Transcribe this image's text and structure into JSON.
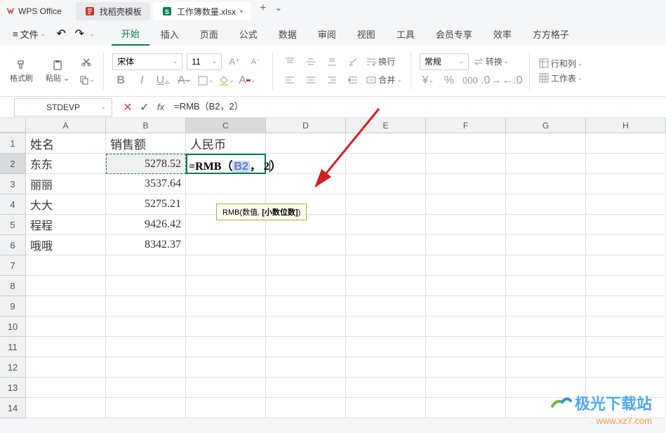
{
  "app": {
    "name": "WPS Office"
  },
  "tabs": [
    {
      "icon_color": "#c0392b",
      "label": "找稻壳模板"
    },
    {
      "icon_color": "#0a8050",
      "label": "工作簿数量.xlsx",
      "active": true
    }
  ],
  "menubar": {
    "file": "文件",
    "items": [
      "开始",
      "插入",
      "页面",
      "公式",
      "数据",
      "审阅",
      "视图",
      "工具",
      "会员专享",
      "效率",
      "方方格子"
    ],
    "active": 0
  },
  "ribbon": {
    "format_brush": "格式刷",
    "paste": "粘贴",
    "font": "宋体",
    "size": "11",
    "wrap": "换行",
    "merge": "合并",
    "numfmt": "常规",
    "convert": "转换",
    "rowcol": "行和列",
    "worksheet": "工作表"
  },
  "formula_bar": {
    "name": "STDEVP",
    "formula": "=RMB（B2，2）"
  },
  "columns": [
    "A",
    "B",
    "C",
    "D",
    "E",
    "F",
    "G",
    "H"
  ],
  "rows_shown": 14,
  "headers": {
    "A": "姓名",
    "B": "销售额",
    "C": "人民币"
  },
  "data": [
    {
      "A": "东东",
      "B": "5278.52"
    },
    {
      "A": "丽丽",
      "B": "3537.64"
    },
    {
      "A": "大大",
      "B": "5275.21"
    },
    {
      "A": "程程",
      "B": "9426.42"
    },
    {
      "A": "哦哦",
      "B": "8342.37"
    }
  ],
  "editing": {
    "prefix": "=RMB（",
    "ref": "B2",
    "mid": "，",
    "arg": "2",
    "suffix": "）"
  },
  "tooltip": {
    "fn": "RMB",
    "args": "(数值, ",
    "highlight": "[小数位数]",
    "end": ")"
  },
  "watermark": {
    "text": "极光下载站",
    "url": "www.xz7.com"
  }
}
